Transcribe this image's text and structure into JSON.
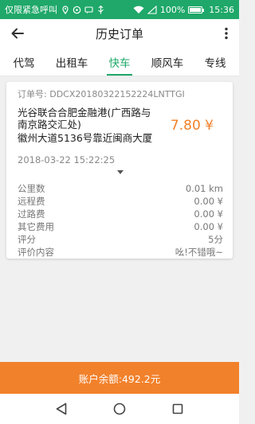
{
  "status_bar": {
    "left_text": "仅限紧急呼叫",
    "battery": "100%",
    "time": "15:36"
  },
  "header": {
    "title": "历史订单"
  },
  "tabs": [
    {
      "label": "代驾"
    },
    {
      "label": "出租车"
    },
    {
      "label": "快车"
    },
    {
      "label": "顺风车"
    },
    {
      "label": "专线"
    }
  ],
  "order": {
    "order_no_label": "订单号:",
    "order_no": "DDCX20180322152224LNTTGI",
    "from": "光谷联合合肥金融港(广西路与南京路交汇处)",
    "to": "徽州大道5136号靠近闽商大厦",
    "price": "7.80 ¥",
    "time": "2018-03-22 15:22:25",
    "fees": [
      {
        "label": "公里数",
        "value": "0.01 km"
      },
      {
        "label": "远程费",
        "value": "0.00 ¥"
      },
      {
        "label": "过路费",
        "value": "0.00 ¥"
      },
      {
        "label": "其它费用",
        "value": "0.00 ¥"
      },
      {
        "label": "评分",
        "value": "5分"
      },
      {
        "label": "评价内容",
        "value": "吆!不错哦~"
      }
    ]
  },
  "balance": {
    "text": "账户余额:492.2元"
  },
  "colors": {
    "accent": "#1fa869",
    "orange": "#f2812b"
  }
}
